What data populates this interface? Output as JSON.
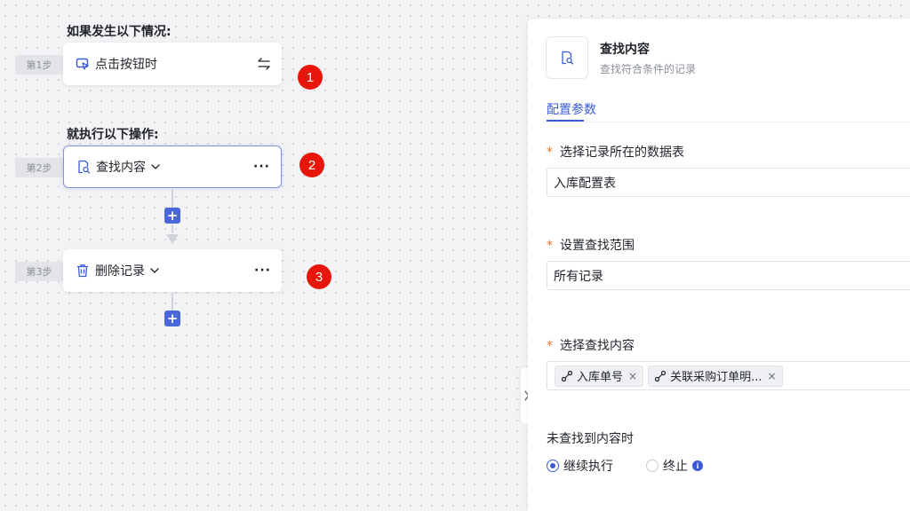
{
  "flow": {
    "trigger_heading": "如果发生以下情况:",
    "action_heading": "就执行以下操作:",
    "steps": [
      {
        "tag": "第1步",
        "label": "点击按钮时",
        "icon": "cursor-click-icon",
        "badge": "1"
      },
      {
        "tag": "第2步",
        "label": "查找内容",
        "icon": "find-record-icon",
        "badge": "2"
      },
      {
        "tag": "第3步",
        "label": "删除记录",
        "icon": "trash-icon",
        "badge": "3"
      }
    ],
    "add_label": "+",
    "more_label": "···"
  },
  "panel": {
    "title": "查找内容",
    "subtitle": "查找符合条件的记录",
    "tab": "配置参数",
    "fields": {
      "table": {
        "label": "选择记录所在的数据表",
        "value": "入库配置表"
      },
      "range": {
        "label": "设置查找范围",
        "value": "所有记录"
      },
      "content": {
        "label": "选择查找内容",
        "tags": [
          "入库单号",
          "关联采购订单明..."
        ]
      }
    },
    "required_mark": "*",
    "not_found": {
      "label": "未查找到内容时",
      "options": [
        "继续执行",
        "终止"
      ],
      "selected": "继续执行"
    },
    "info_mark": "i",
    "remove_mark": "×"
  },
  "colors": {
    "accent": "#3b5bd6",
    "badge": "#e8150a",
    "required": "#e3792b"
  }
}
